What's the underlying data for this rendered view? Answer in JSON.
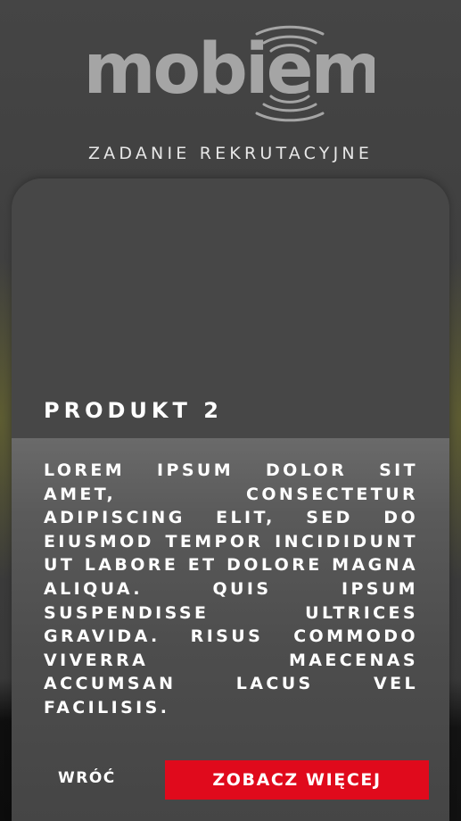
{
  "header": {
    "logo_text": "mobiem",
    "subtitle": "ZADANIE REKRUTACYJNE"
  },
  "card": {
    "title": "PRODUKT 2",
    "description": "LOREM IPSUM DOLOR SIT AMET, CONSECTETUR ADIPISCING ELIT, SED DO EIUSMOD TEMPOR INCIDIDUNT UT LABORE ET DOLORE MAGNA ALIQUA. QUIS IPSUM SUSPENDISSE ULTRICES GRAVIDA. RISUS COMMODO VIVERRA MAECENAS ACCUMSAN LACUS VEL FACILISIS.",
    "back_label": "WRÓĆ",
    "more_label": "ZOBACZ WIĘCEJ"
  },
  "colors": {
    "accent": "#e00a1c",
    "logo": "#a5a5a5",
    "background": "#3e3e3e"
  },
  "icons": {
    "logo_waves": "signal-waves-icon"
  }
}
